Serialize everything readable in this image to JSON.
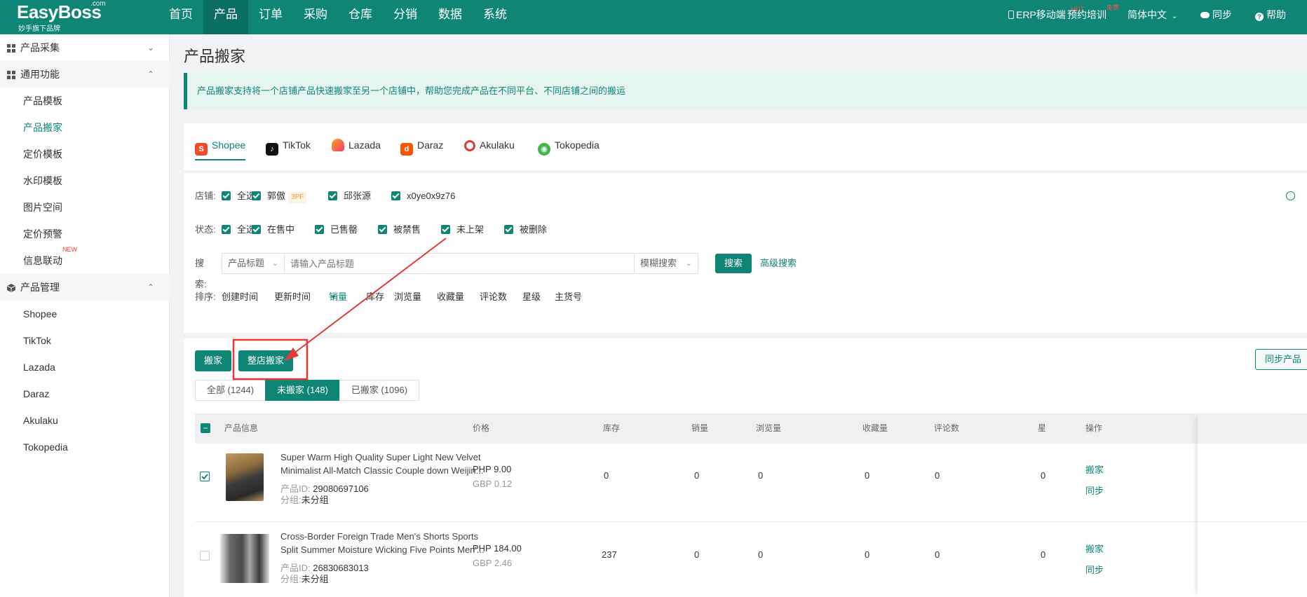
{
  "topbar": {
    "logo": {
      "name": "EasyBoss",
      "com": ".com",
      "sub": "妙手旗下品牌"
    },
    "nav": [
      "首页",
      "产品",
      "订单",
      "采购",
      "仓库",
      "分销",
      "数据",
      "系统"
    ],
    "active_nav": "产品",
    "right": {
      "erp_mobile": "ERP移动端",
      "erp_badge": "HOT",
      "training": "预约培训",
      "training_badge": "免费",
      "language": "简体中文",
      "sync": "同步",
      "help": "帮助"
    }
  },
  "sidebar": {
    "groups": [
      {
        "label": "产品采集",
        "expanded": false
      },
      {
        "label": "通用功能",
        "expanded": true
      },
      {
        "label": "产品管理",
        "expanded": true
      }
    ],
    "general_items": [
      "产品模板",
      "产品搬家",
      "定价模板",
      "水印模板",
      "图片空间",
      "定价预警",
      "信息联动"
    ],
    "new_badge": "NEW",
    "manage_items": [
      "Shopee",
      "TikTok",
      "Lazada",
      "Daraz",
      "Akulaku",
      "Tokopedia"
    ],
    "active_item": "产品搬家"
  },
  "page": {
    "title": "产品搬家",
    "notice": "产品搬家支持将一个店铺产品快速搬家至另一个店铺中，帮助您完成产品在不同平台、不同店铺之间的搬运"
  },
  "platform_tabs": [
    {
      "label": "Shopee",
      "icon": "shopee-icon",
      "color": "#ee4d2d"
    },
    {
      "label": "TikTok",
      "icon": "tiktok-icon",
      "color": "#111111"
    },
    {
      "label": "Lazada",
      "icon": "lazada-icon",
      "color": "#f57224"
    },
    {
      "label": "Daraz",
      "icon": "daraz-icon",
      "color": "#f85606"
    },
    {
      "label": "Akulaku",
      "icon": "akulaku-icon",
      "color": "#e4393c"
    },
    {
      "label": "Tokopedia",
      "icon": "tokopedia-icon",
      "color": "#42b549"
    }
  ],
  "active_platform": "Shopee",
  "filters": {
    "shop_label": "店铺:",
    "shops": [
      "全选",
      "郭傲",
      "邱张源",
      "x0ye0x9z76"
    ],
    "shop_tag": "3PF",
    "status_label": "状态:",
    "statuses": [
      "全选",
      "在售中",
      "已售罄",
      "被禁售",
      "未上架",
      "被删除"
    ],
    "search_label": "搜索:",
    "search_field": "产品标题",
    "search_placeholder": "请输入产品标题",
    "search_mode": "模糊搜索",
    "search_button": "搜索",
    "advanced_search": "高级搜索",
    "sort_label": "排序:",
    "sort_options": [
      "创建时间",
      "更新时间",
      "销量",
      "库存",
      "浏览量",
      "收藏量",
      "评论数",
      "星级",
      "主货号"
    ],
    "active_sort": "销量"
  },
  "actions": {
    "move": "搬家",
    "move_whole_shop": "整店搬家",
    "sync_products": "同步产品"
  },
  "list_tabs": [
    {
      "label": "全部 (1244)",
      "active": false
    },
    {
      "label": "未搬家 (148)",
      "active": true
    },
    {
      "label": "已搬家 (1096)",
      "active": false
    }
  ],
  "table": {
    "columns": [
      "产品信息",
      "价格",
      "库存",
      "销量",
      "浏览量",
      "收藏量",
      "评论数",
      "星",
      "操作"
    ],
    "id_label": "产品ID:",
    "group_label": "分组:",
    "rows": [
      {
        "checked": true,
        "title_line1": "Super Warm High Quality Super Light New Velvet",
        "title_line2": "Minimalist All-Match Classic Couple down Weijin...",
        "id": "29080697106",
        "group": "未分组",
        "price1": "PHP 9.00",
        "price2": "GBP 0.12",
        "stock": "0",
        "sales": "0",
        "views": "0",
        "favorites": "0",
        "reviews": "0",
        "star": "0",
        "ops": [
          "搬家",
          "同步"
        ]
      },
      {
        "checked": false,
        "title_line1": "Cross-Border Foreign Trade Men's Shorts Sports",
        "title_line2": "Split Summer Moisture Wicking Five Points Men'...",
        "id": "26830683013",
        "group": "未分组",
        "price1": "PHP 184.00",
        "price2": "GBP 2.46",
        "stock": "237",
        "sales": "0",
        "views": "0",
        "favorites": "0",
        "reviews": "0",
        "star": "0",
        "ops": [
          "搬家",
          "同步"
        ]
      }
    ]
  },
  "colors": {
    "primary": "#0e8575",
    "annotation": "#e53935"
  }
}
